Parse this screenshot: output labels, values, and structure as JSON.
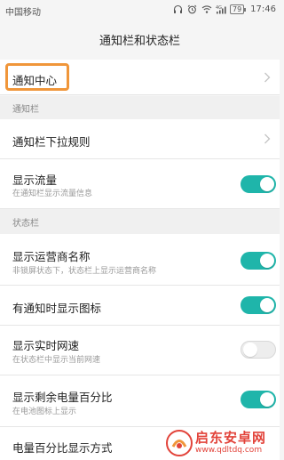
{
  "status_bar": {
    "carrier": "中国移动",
    "battery": "79",
    "time": "17:46",
    "icons": [
      "headphones-icon",
      "alarm-icon",
      "wifi-icon",
      "signal-4g-icon",
      "battery-icon"
    ]
  },
  "header": {
    "title": "通知栏和状态栏"
  },
  "rows": {
    "notification_center": {
      "title": "通知中心"
    },
    "pulldown_rule": {
      "title": "通知栏下拉规则"
    },
    "show_traffic": {
      "title": "显示流量",
      "subtitle": "在通知栏显示流量信息",
      "on": true
    },
    "show_carrier": {
      "title": "显示运营商名称",
      "subtitle": "非锁屏状态下，状态栏上显示运营商名称",
      "on": true
    },
    "show_notif_icon": {
      "title": "有通知时显示图标",
      "on": true
    },
    "show_speed": {
      "title": "显示实时网速",
      "subtitle": "在状态栏中显示当前网速",
      "on": false
    },
    "show_battery_pct": {
      "title": "显示剩余电量百分比",
      "subtitle": "在电池图标上显示",
      "on": true
    },
    "battery_pct_mode": {
      "title": "电量百分比显示方式"
    }
  },
  "groups": {
    "notification_bar": "通知栏",
    "status_bar": "状态栏"
  },
  "watermark": {
    "name": "启东安卓网",
    "url": "www.qdltdq.com"
  },
  "colors": {
    "accent": "#1fb5aa",
    "highlight": "#f0963a",
    "watermark": "#e2433a"
  }
}
